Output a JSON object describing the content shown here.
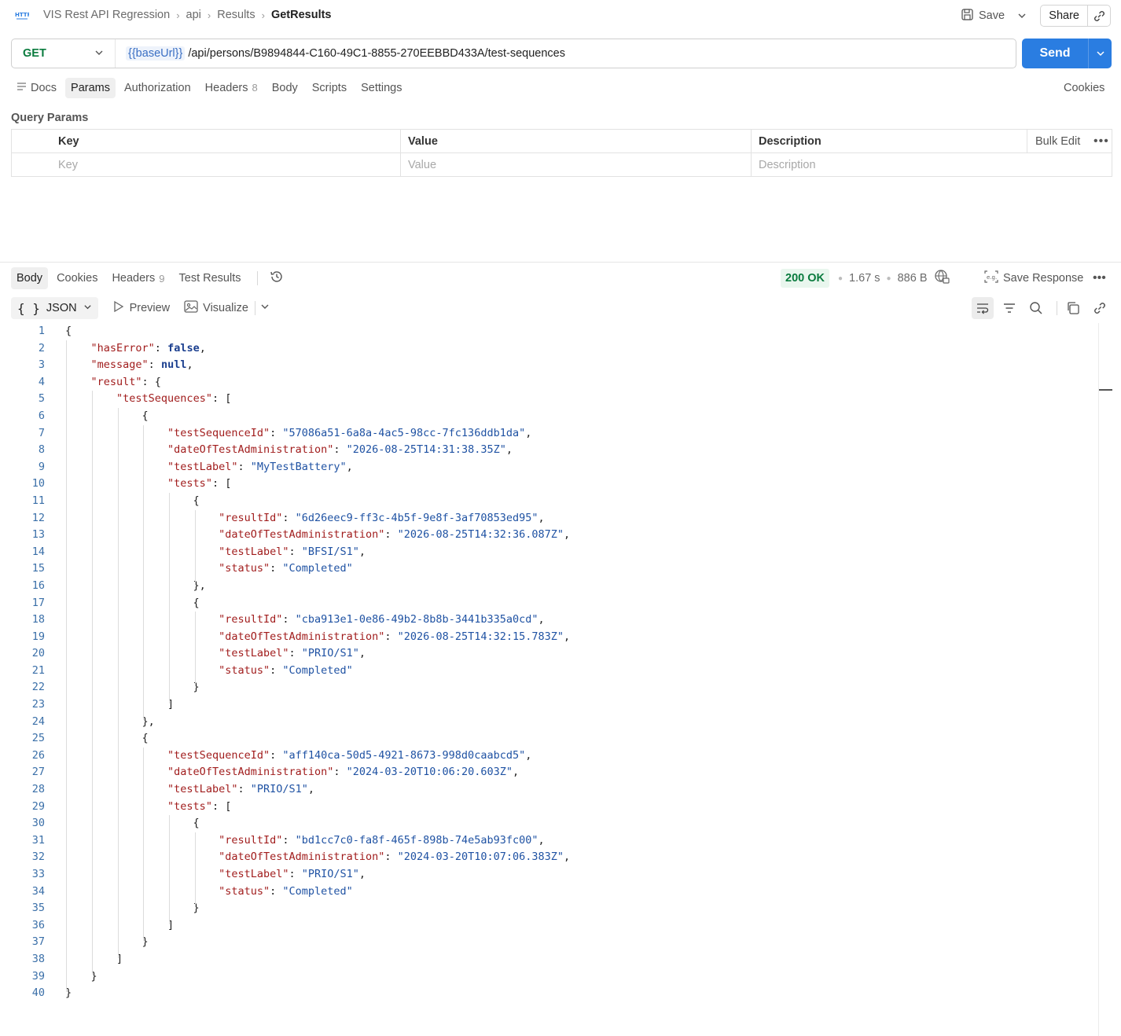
{
  "header": {
    "app_icon": "http-icon",
    "breadcrumb": [
      "VIS Rest API Regression",
      "api",
      "Results"
    ],
    "current": "GetResults",
    "save_label": "Save",
    "share_label": "Share"
  },
  "request": {
    "method": "GET",
    "url_variable": "{{baseUrl}}",
    "url_path": "/api/persons/B9894844-C160-49C1-8855-270EEBBD433A/test-sequences",
    "send_label": "Send"
  },
  "request_tabs": {
    "docs": "Docs",
    "params": "Params",
    "authorization": "Authorization",
    "headers": "Headers",
    "headers_count": "8",
    "body": "Body",
    "scripts": "Scripts",
    "settings": "Settings",
    "cookies": "Cookies",
    "active": "Params"
  },
  "query_params": {
    "title": "Query Params",
    "headers": [
      "Key",
      "Value",
      "Description"
    ],
    "placeholders": [
      "Key",
      "Value",
      "Description"
    ],
    "bulk_edit": "Bulk Edit"
  },
  "response": {
    "tabs": {
      "body": "Body",
      "cookies": "Cookies",
      "headers": "Headers",
      "headers_count": "9",
      "test_results": "Test Results"
    },
    "status": "200 OK",
    "time": "1.67 s",
    "size": "886 B",
    "save_response": "Save Response",
    "format": "JSON",
    "preview": "Preview",
    "visualize": "Visualize"
  },
  "json_body": [
    "{",
    "    \"hasError\": false,",
    "    \"message\": null,",
    "    \"result\": {",
    "        \"testSequences\": [",
    "            {",
    "                \"testSequenceId\": \"57086a51-6a8a-4ac5-98cc-7fc136ddb1da\",",
    "                \"dateOfTestAdministration\": \"2026-08-25T14:31:38.35Z\",",
    "                \"testLabel\": \"MyTestBattery\",",
    "                \"tests\": [",
    "                    {",
    "                        \"resultId\": \"6d26eec9-ff3c-4b5f-9e8f-3af70853ed95\",",
    "                        \"dateOfTestAdministration\": \"2026-08-25T14:32:36.087Z\",",
    "                        \"testLabel\": \"BFSI/S1\",",
    "                        \"status\": \"Completed\"",
    "                    },",
    "                    {",
    "                        \"resultId\": \"cba913e1-0e86-49b2-8b8b-3441b335a0cd\",",
    "                        \"dateOfTestAdministration\": \"2026-08-25T14:32:15.783Z\",",
    "                        \"testLabel\": \"PRIO/S1\",",
    "                        \"status\": \"Completed\"",
    "                    }",
    "                ]",
    "            },",
    "            {",
    "                \"testSequenceId\": \"aff140ca-50d5-4921-8673-998d0caabcd5\",",
    "                \"dateOfTestAdministration\": \"2024-03-20T10:06:20.603Z\",",
    "                \"testLabel\": \"PRIO/S1\",",
    "                \"tests\": [",
    "                    {",
    "                        \"resultId\": \"bd1cc7c0-fa8f-465f-898b-74e5ab93fc00\",",
    "                        \"dateOfTestAdministration\": \"2024-03-20T10:07:06.383Z\",",
    "                        \"testLabel\": \"PRIO/S1\",",
    "                        \"status\": \"Completed\"",
    "                    }",
    "                ]",
    "            }",
    "        ]",
    "    }",
    "}"
  ],
  "colors": {
    "accent": "#2a7de1",
    "method_get": "#0a7b3e",
    "status_ok_bg": "#e9f6ee",
    "json_key": "#a11d1d",
    "json_string": "#1f52a3",
    "line_number": "#3a6fa8"
  }
}
